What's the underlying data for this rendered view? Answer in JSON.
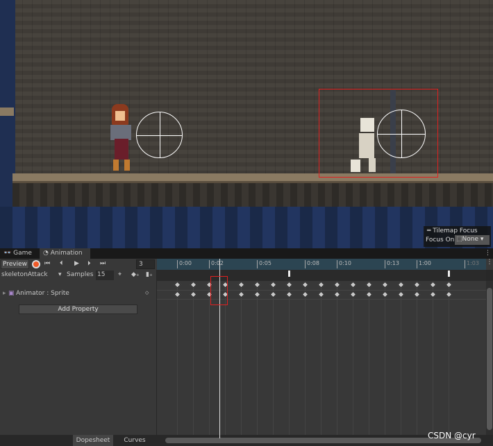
{
  "scene": {
    "tilemap_focus": {
      "title": "Tilemap Focus",
      "label": "Focus On",
      "value": "None"
    }
  },
  "tabs": [
    {
      "label": "Game",
      "icon": "gamepad-icon"
    },
    {
      "label": "Animation",
      "icon": "animation-clock-icon",
      "active": true
    }
  ],
  "toolbar": {
    "preview": "Preview",
    "frame": "3",
    "clip": "skeletonAttack",
    "samples_label": "Samples",
    "samples": "15"
  },
  "properties": [
    {
      "label": "Animator : Sprite"
    }
  ],
  "add_property": "Add Property",
  "timeline": {
    "labels": [
      "0:00",
      "0:02",
      "0:05",
      "0:08",
      "0:10",
      "0:13",
      "1:00",
      "1:03"
    ],
    "current_frame": 3,
    "keyframe_count": 18,
    "event_frames": [
      7,
      17
    ]
  },
  "bottom": {
    "dopesheet": "Dopesheet",
    "curves": "Curves"
  },
  "watermark": "CSDN @cyr",
  "colors": {
    "record": "#f05a28",
    "selection": "#e02020",
    "ruler": "#2c4552"
  }
}
